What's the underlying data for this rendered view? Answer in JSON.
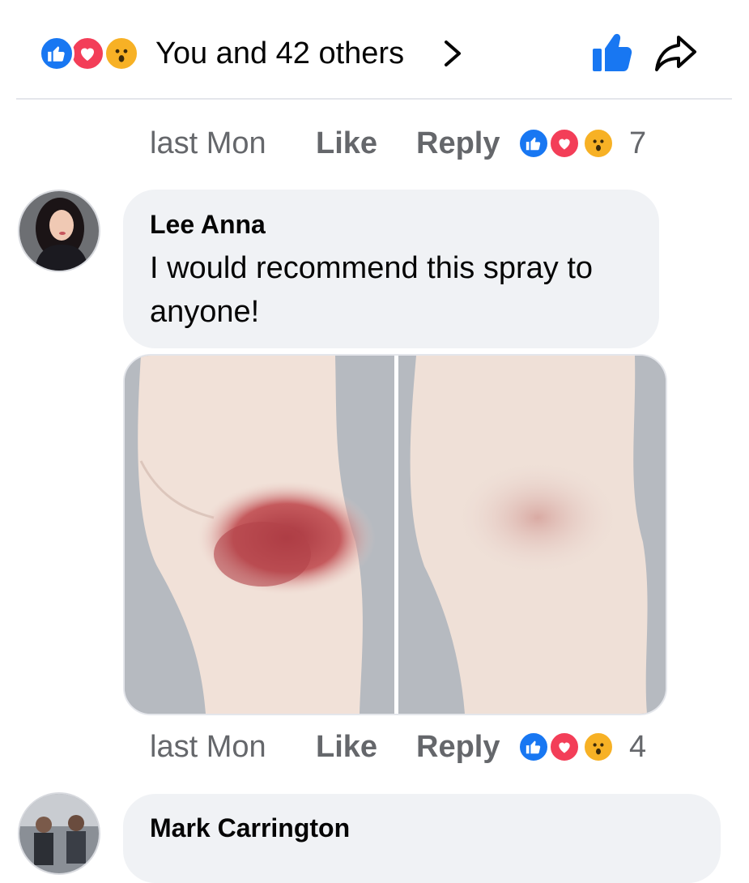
{
  "reaction_summary": {
    "text": "You and 42 others",
    "icons": [
      "like-icon",
      "love-icon",
      "wow-icon"
    ]
  },
  "actions": {
    "like_icon": "thumbs-up-icon",
    "share_icon": "share-arrow-icon"
  },
  "comments": [
    {
      "time": "last Mon",
      "like_label": "Like",
      "reply_label": "Reply",
      "reaction_count": "7"
    },
    {
      "author": "Lee Anna",
      "text": "I would recommend this spray to anyone!",
      "time": "last Mon",
      "like_label": "Like",
      "reply_label": "Reply",
      "reaction_count": "4",
      "photo": "before-after-knee-photo"
    },
    {
      "author": "Mark Carrington"
    }
  ],
  "colors": {
    "like_blue": "#1877f2",
    "love_red": "#f33e58",
    "wow_yellow": "#f7b125",
    "bubble_bg": "#f0f2f5",
    "meta_gray": "#65676b"
  }
}
